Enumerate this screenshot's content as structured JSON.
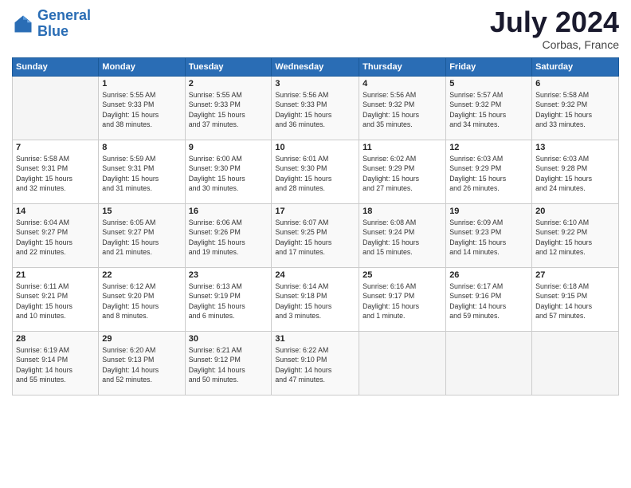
{
  "header": {
    "logo_line1": "General",
    "logo_line2": "Blue",
    "month_year": "July 2024",
    "location": "Corbas, France"
  },
  "calendar": {
    "headers": [
      "Sunday",
      "Monday",
      "Tuesday",
      "Wednesday",
      "Thursday",
      "Friday",
      "Saturday"
    ],
    "weeks": [
      [
        {
          "day": "",
          "info": ""
        },
        {
          "day": "1",
          "info": "Sunrise: 5:55 AM\nSunset: 9:33 PM\nDaylight: 15 hours\nand 38 minutes."
        },
        {
          "day": "2",
          "info": "Sunrise: 5:55 AM\nSunset: 9:33 PM\nDaylight: 15 hours\nand 37 minutes."
        },
        {
          "day": "3",
          "info": "Sunrise: 5:56 AM\nSunset: 9:33 PM\nDaylight: 15 hours\nand 36 minutes."
        },
        {
          "day": "4",
          "info": "Sunrise: 5:56 AM\nSunset: 9:32 PM\nDaylight: 15 hours\nand 35 minutes."
        },
        {
          "day": "5",
          "info": "Sunrise: 5:57 AM\nSunset: 9:32 PM\nDaylight: 15 hours\nand 34 minutes."
        },
        {
          "day": "6",
          "info": "Sunrise: 5:58 AM\nSunset: 9:32 PM\nDaylight: 15 hours\nand 33 minutes."
        }
      ],
      [
        {
          "day": "7",
          "info": "Sunrise: 5:58 AM\nSunset: 9:31 PM\nDaylight: 15 hours\nand 32 minutes."
        },
        {
          "day": "8",
          "info": "Sunrise: 5:59 AM\nSunset: 9:31 PM\nDaylight: 15 hours\nand 31 minutes."
        },
        {
          "day": "9",
          "info": "Sunrise: 6:00 AM\nSunset: 9:30 PM\nDaylight: 15 hours\nand 30 minutes."
        },
        {
          "day": "10",
          "info": "Sunrise: 6:01 AM\nSunset: 9:30 PM\nDaylight: 15 hours\nand 28 minutes."
        },
        {
          "day": "11",
          "info": "Sunrise: 6:02 AM\nSunset: 9:29 PM\nDaylight: 15 hours\nand 27 minutes."
        },
        {
          "day": "12",
          "info": "Sunrise: 6:03 AM\nSunset: 9:29 PM\nDaylight: 15 hours\nand 26 minutes."
        },
        {
          "day": "13",
          "info": "Sunrise: 6:03 AM\nSunset: 9:28 PM\nDaylight: 15 hours\nand 24 minutes."
        }
      ],
      [
        {
          "day": "14",
          "info": "Sunrise: 6:04 AM\nSunset: 9:27 PM\nDaylight: 15 hours\nand 22 minutes."
        },
        {
          "day": "15",
          "info": "Sunrise: 6:05 AM\nSunset: 9:27 PM\nDaylight: 15 hours\nand 21 minutes."
        },
        {
          "day": "16",
          "info": "Sunrise: 6:06 AM\nSunset: 9:26 PM\nDaylight: 15 hours\nand 19 minutes."
        },
        {
          "day": "17",
          "info": "Sunrise: 6:07 AM\nSunset: 9:25 PM\nDaylight: 15 hours\nand 17 minutes."
        },
        {
          "day": "18",
          "info": "Sunrise: 6:08 AM\nSunset: 9:24 PM\nDaylight: 15 hours\nand 15 minutes."
        },
        {
          "day": "19",
          "info": "Sunrise: 6:09 AM\nSunset: 9:23 PM\nDaylight: 15 hours\nand 14 minutes."
        },
        {
          "day": "20",
          "info": "Sunrise: 6:10 AM\nSunset: 9:22 PM\nDaylight: 15 hours\nand 12 minutes."
        }
      ],
      [
        {
          "day": "21",
          "info": "Sunrise: 6:11 AM\nSunset: 9:21 PM\nDaylight: 15 hours\nand 10 minutes."
        },
        {
          "day": "22",
          "info": "Sunrise: 6:12 AM\nSunset: 9:20 PM\nDaylight: 15 hours\nand 8 minutes."
        },
        {
          "day": "23",
          "info": "Sunrise: 6:13 AM\nSunset: 9:19 PM\nDaylight: 15 hours\nand 6 minutes."
        },
        {
          "day": "24",
          "info": "Sunrise: 6:14 AM\nSunset: 9:18 PM\nDaylight: 15 hours\nand 3 minutes."
        },
        {
          "day": "25",
          "info": "Sunrise: 6:16 AM\nSunset: 9:17 PM\nDaylight: 15 hours\nand 1 minute."
        },
        {
          "day": "26",
          "info": "Sunrise: 6:17 AM\nSunset: 9:16 PM\nDaylight: 14 hours\nand 59 minutes."
        },
        {
          "day": "27",
          "info": "Sunrise: 6:18 AM\nSunset: 9:15 PM\nDaylight: 14 hours\nand 57 minutes."
        }
      ],
      [
        {
          "day": "28",
          "info": "Sunrise: 6:19 AM\nSunset: 9:14 PM\nDaylight: 14 hours\nand 55 minutes."
        },
        {
          "day": "29",
          "info": "Sunrise: 6:20 AM\nSunset: 9:13 PM\nDaylight: 14 hours\nand 52 minutes."
        },
        {
          "day": "30",
          "info": "Sunrise: 6:21 AM\nSunset: 9:12 PM\nDaylight: 14 hours\nand 50 minutes."
        },
        {
          "day": "31",
          "info": "Sunrise: 6:22 AM\nSunset: 9:10 PM\nDaylight: 14 hours\nand 47 minutes."
        },
        {
          "day": "",
          "info": ""
        },
        {
          "day": "",
          "info": ""
        },
        {
          "day": "",
          "info": ""
        }
      ]
    ]
  }
}
